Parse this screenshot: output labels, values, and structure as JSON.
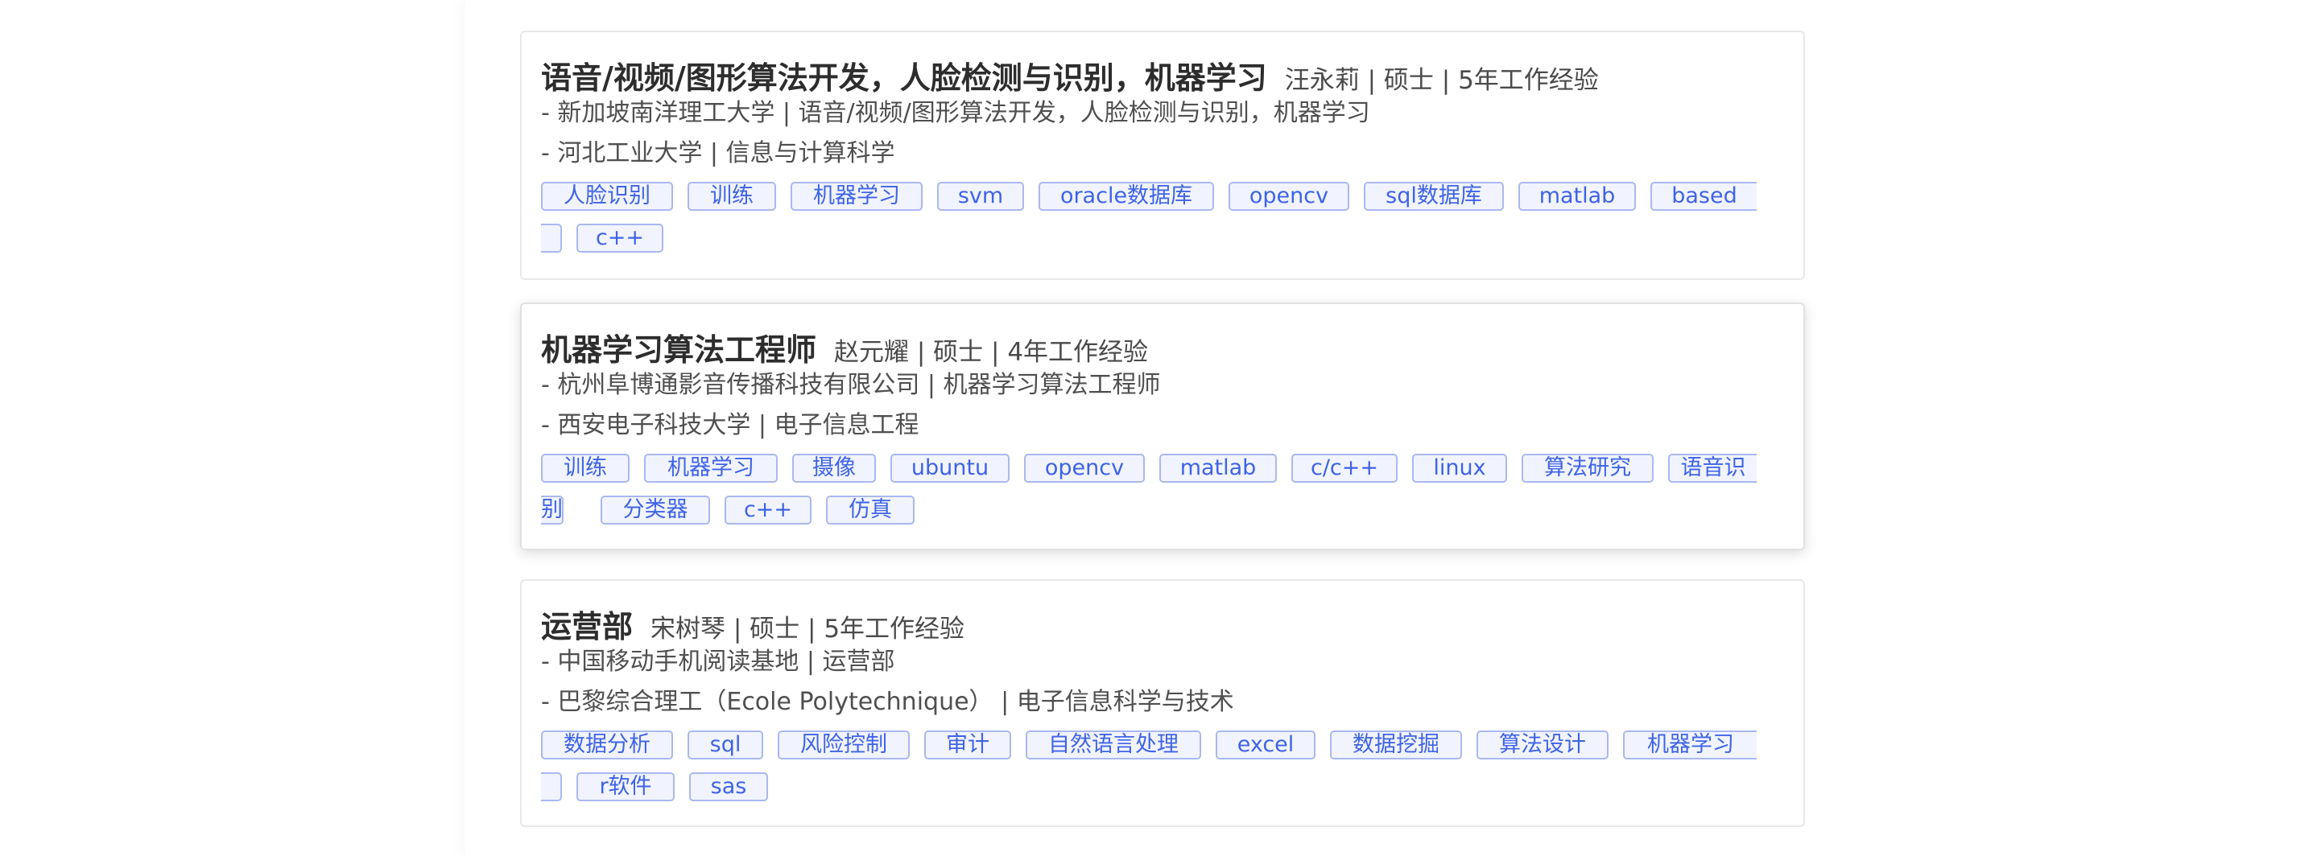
{
  "cards": [
    {
      "title": "语音/视频/图形算法开发，人脸检测与识别，机器学习",
      "meta": "汪永莉 | 硕士 | 5年工作经验",
      "details": [
        "- 新加坡南洋理工大学 | 语音/视频/图形算法开发，人脸检测与识别，机器学习",
        "- 河北工业大学 | 信息与计算科学"
      ],
      "tags_row1": [
        "人脸识别",
        "训练",
        "机器学习",
        "svm",
        "oracle数据库",
        "opencv",
        "sql数据库",
        "matlab",
        "based"
      ],
      "tags_row2": [
        "",
        "c++"
      ]
    },
    {
      "title": "机器学习算法工程师",
      "meta": "赵元耀 | 硕士 | 4年工作经验",
      "details": [
        "- 杭州阜博通影音传播科技有限公司 | 机器学习算法工程师",
        "- 西安电子科技大学 | 电子信息工程"
      ],
      "tags_row1": [
        "训练",
        "机器学习",
        "摄像",
        "ubuntu",
        "opencv",
        "matlab",
        "c/c++",
        "linux",
        "算法研究",
        "语音识"
      ],
      "tags_row2": [
        "别",
        "分类器",
        "c++",
        "仿真"
      ]
    },
    {
      "title": "运营部",
      "meta": "宋树琴 | 硕士 | 5年工作经验",
      "details": [
        "- 中国移动手机阅读基地 | 运营部",
        "- 巴黎综合理工（Ecole Polytechnique） | 电子信息科学与技术"
      ],
      "tags_row1": [
        "数据分析",
        "sql",
        "风险控制",
        "审计",
        "自然语言处理",
        "excel",
        "数据挖掘",
        "算法设计",
        "机器学习"
      ],
      "tags_row2": [
        "",
        "r软件",
        "sas"
      ]
    }
  ]
}
